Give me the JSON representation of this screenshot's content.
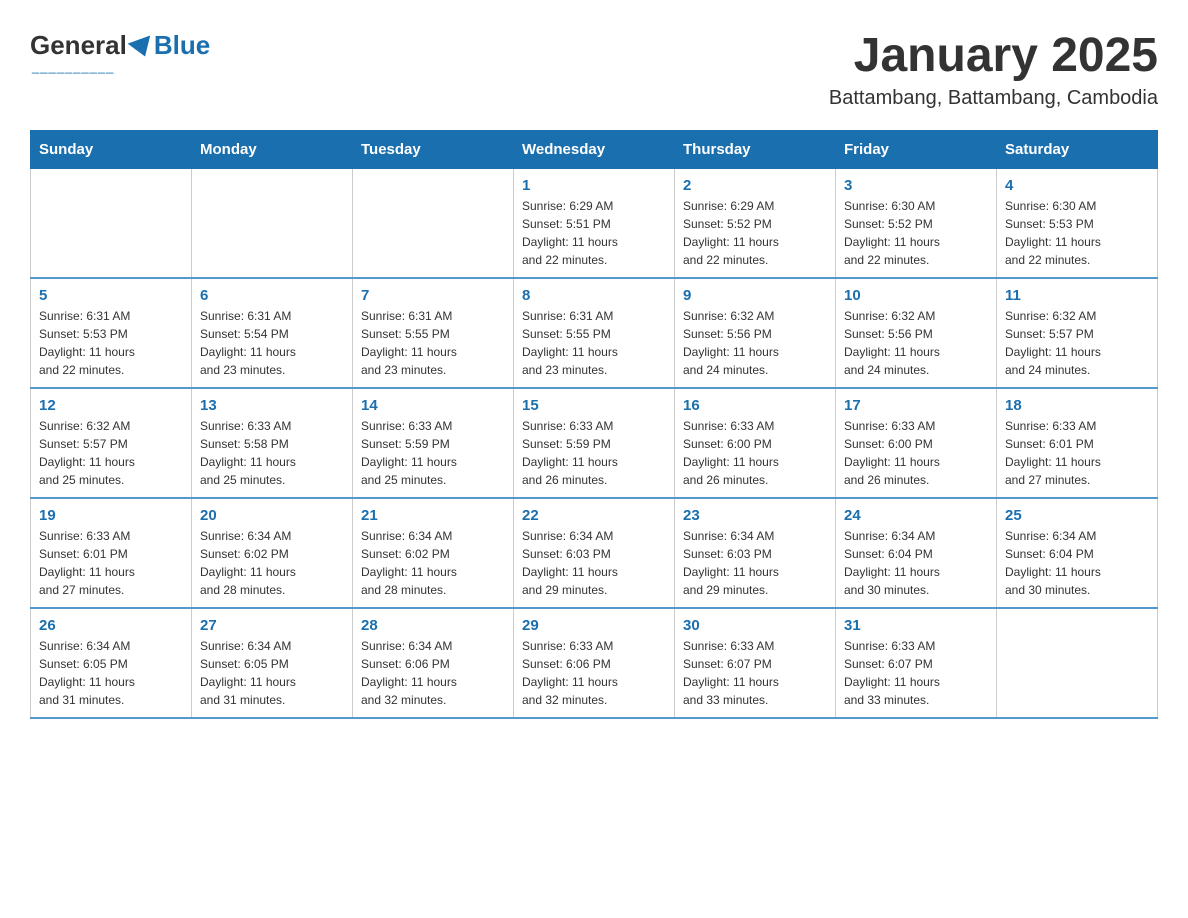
{
  "header": {
    "logo_general": "General",
    "logo_blue": "Blue",
    "main_title": "January 2025",
    "subtitle": "Battambang, Battambang, Cambodia"
  },
  "weekdays": [
    "Sunday",
    "Monday",
    "Tuesday",
    "Wednesday",
    "Thursday",
    "Friday",
    "Saturday"
  ],
  "weeks": [
    [
      {
        "day": "",
        "info": ""
      },
      {
        "day": "",
        "info": ""
      },
      {
        "day": "",
        "info": ""
      },
      {
        "day": "1",
        "info": "Sunrise: 6:29 AM\nSunset: 5:51 PM\nDaylight: 11 hours\nand 22 minutes."
      },
      {
        "day": "2",
        "info": "Sunrise: 6:29 AM\nSunset: 5:52 PM\nDaylight: 11 hours\nand 22 minutes."
      },
      {
        "day": "3",
        "info": "Sunrise: 6:30 AM\nSunset: 5:52 PM\nDaylight: 11 hours\nand 22 minutes."
      },
      {
        "day": "4",
        "info": "Sunrise: 6:30 AM\nSunset: 5:53 PM\nDaylight: 11 hours\nand 22 minutes."
      }
    ],
    [
      {
        "day": "5",
        "info": "Sunrise: 6:31 AM\nSunset: 5:53 PM\nDaylight: 11 hours\nand 22 minutes."
      },
      {
        "day": "6",
        "info": "Sunrise: 6:31 AM\nSunset: 5:54 PM\nDaylight: 11 hours\nand 23 minutes."
      },
      {
        "day": "7",
        "info": "Sunrise: 6:31 AM\nSunset: 5:55 PM\nDaylight: 11 hours\nand 23 minutes."
      },
      {
        "day": "8",
        "info": "Sunrise: 6:31 AM\nSunset: 5:55 PM\nDaylight: 11 hours\nand 23 minutes."
      },
      {
        "day": "9",
        "info": "Sunrise: 6:32 AM\nSunset: 5:56 PM\nDaylight: 11 hours\nand 24 minutes."
      },
      {
        "day": "10",
        "info": "Sunrise: 6:32 AM\nSunset: 5:56 PM\nDaylight: 11 hours\nand 24 minutes."
      },
      {
        "day": "11",
        "info": "Sunrise: 6:32 AM\nSunset: 5:57 PM\nDaylight: 11 hours\nand 24 minutes."
      }
    ],
    [
      {
        "day": "12",
        "info": "Sunrise: 6:32 AM\nSunset: 5:57 PM\nDaylight: 11 hours\nand 25 minutes."
      },
      {
        "day": "13",
        "info": "Sunrise: 6:33 AM\nSunset: 5:58 PM\nDaylight: 11 hours\nand 25 minutes."
      },
      {
        "day": "14",
        "info": "Sunrise: 6:33 AM\nSunset: 5:59 PM\nDaylight: 11 hours\nand 25 minutes."
      },
      {
        "day": "15",
        "info": "Sunrise: 6:33 AM\nSunset: 5:59 PM\nDaylight: 11 hours\nand 26 minutes."
      },
      {
        "day": "16",
        "info": "Sunrise: 6:33 AM\nSunset: 6:00 PM\nDaylight: 11 hours\nand 26 minutes."
      },
      {
        "day": "17",
        "info": "Sunrise: 6:33 AM\nSunset: 6:00 PM\nDaylight: 11 hours\nand 26 minutes."
      },
      {
        "day": "18",
        "info": "Sunrise: 6:33 AM\nSunset: 6:01 PM\nDaylight: 11 hours\nand 27 minutes."
      }
    ],
    [
      {
        "day": "19",
        "info": "Sunrise: 6:33 AM\nSunset: 6:01 PM\nDaylight: 11 hours\nand 27 minutes."
      },
      {
        "day": "20",
        "info": "Sunrise: 6:34 AM\nSunset: 6:02 PM\nDaylight: 11 hours\nand 28 minutes."
      },
      {
        "day": "21",
        "info": "Sunrise: 6:34 AM\nSunset: 6:02 PM\nDaylight: 11 hours\nand 28 minutes."
      },
      {
        "day": "22",
        "info": "Sunrise: 6:34 AM\nSunset: 6:03 PM\nDaylight: 11 hours\nand 29 minutes."
      },
      {
        "day": "23",
        "info": "Sunrise: 6:34 AM\nSunset: 6:03 PM\nDaylight: 11 hours\nand 29 minutes."
      },
      {
        "day": "24",
        "info": "Sunrise: 6:34 AM\nSunset: 6:04 PM\nDaylight: 11 hours\nand 30 minutes."
      },
      {
        "day": "25",
        "info": "Sunrise: 6:34 AM\nSunset: 6:04 PM\nDaylight: 11 hours\nand 30 minutes."
      }
    ],
    [
      {
        "day": "26",
        "info": "Sunrise: 6:34 AM\nSunset: 6:05 PM\nDaylight: 11 hours\nand 31 minutes."
      },
      {
        "day": "27",
        "info": "Sunrise: 6:34 AM\nSunset: 6:05 PM\nDaylight: 11 hours\nand 31 minutes."
      },
      {
        "day": "28",
        "info": "Sunrise: 6:34 AM\nSunset: 6:06 PM\nDaylight: 11 hours\nand 32 minutes."
      },
      {
        "day": "29",
        "info": "Sunrise: 6:33 AM\nSunset: 6:06 PM\nDaylight: 11 hours\nand 32 minutes."
      },
      {
        "day": "30",
        "info": "Sunrise: 6:33 AM\nSunset: 6:07 PM\nDaylight: 11 hours\nand 33 minutes."
      },
      {
        "day": "31",
        "info": "Sunrise: 6:33 AM\nSunset: 6:07 PM\nDaylight: 11 hours\nand 33 minutes."
      },
      {
        "day": "",
        "info": ""
      }
    ]
  ]
}
